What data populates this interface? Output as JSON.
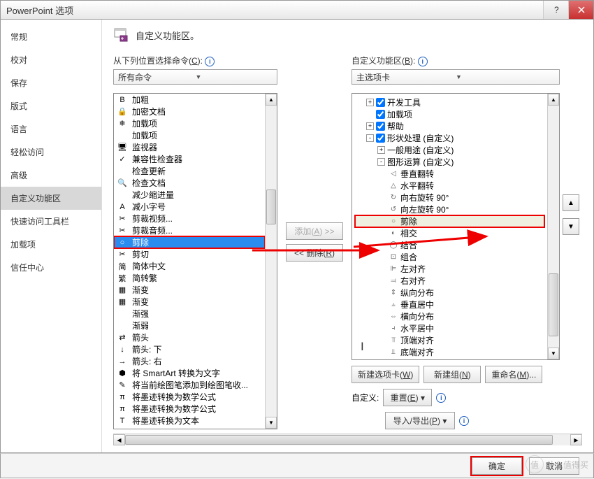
{
  "window": {
    "title": "PowerPoint 选项"
  },
  "sidebar": {
    "items": [
      "常规",
      "校对",
      "保存",
      "版式",
      "语言",
      "轻松访问",
      "高级",
      "自定义功能区",
      "快速访问工具栏",
      "加载项",
      "信任中心"
    ],
    "selectedIndex": 7
  },
  "header": {
    "title": "自定义功能区。"
  },
  "leftPanel": {
    "label_pre": "从下列位置选择命令(",
    "label_key": "C",
    "label_post": "):",
    "dropdown": "所有命令",
    "items": [
      {
        "icon": "B",
        "label": "加粗"
      },
      {
        "icon": "🔒",
        "label": "加密文档"
      },
      {
        "icon": "❄",
        "label": "加载项"
      },
      {
        "icon": "",
        "label": "加载项"
      },
      {
        "icon": "🖥",
        "label": "监视器"
      },
      {
        "icon": "✓",
        "label": "兼容性检查器"
      },
      {
        "icon": "",
        "label": "检查更新"
      },
      {
        "icon": "🔍",
        "label": "检查文档"
      },
      {
        "icon": "",
        "label": "减少缩进量"
      },
      {
        "icon": "A",
        "label": "减小字号"
      },
      {
        "icon": "✂",
        "label": "剪裁视频..."
      },
      {
        "icon": "✂",
        "label": "剪裁音频..."
      },
      {
        "icon": "○",
        "label": "剪除",
        "selected": true,
        "redBorder": true
      },
      {
        "icon": "✂",
        "label": "剪切"
      },
      {
        "icon": "简",
        "label": "简体中文"
      },
      {
        "icon": "繁",
        "label": "简转繁"
      },
      {
        "icon": "▦",
        "label": "渐变"
      },
      {
        "icon": "▦",
        "label": "渐变"
      },
      {
        "icon": "",
        "label": "渐强"
      },
      {
        "icon": "",
        "label": "渐弱"
      },
      {
        "icon": "⇄",
        "label": "箭头"
      },
      {
        "icon": "↓",
        "label": "箭头: 下"
      },
      {
        "icon": "→",
        "label": "箭头: 右"
      },
      {
        "icon": "⬢",
        "label": "将 SmartArt 转换为文字"
      },
      {
        "icon": "✎",
        "label": "将当前绘图笔添加到绘图笔收..."
      },
      {
        "icon": "π",
        "label": "将墨迹转换为数学公式"
      },
      {
        "icon": "π",
        "label": "将墨迹转换为数学公式"
      },
      {
        "icon": "T",
        "label": "将墨迹转换为文本"
      }
    ]
  },
  "middle": {
    "add_pre": "添加(",
    "add_key": "A",
    "add_post": ") >>",
    "remove_pre": "<< 删除(",
    "remove_key": "R",
    "remove_post": ")"
  },
  "rightPanel": {
    "label_pre": "自定义功能区(",
    "label_key": "B",
    "label_post": "):",
    "dropdown": "主选项卡",
    "tree": [
      {
        "type": "tab",
        "expand": "+",
        "checked": true,
        "label": "开发工具",
        "indent": 1
      },
      {
        "type": "tab",
        "expand": "",
        "checked": true,
        "label": "加载项",
        "indent": 1
      },
      {
        "type": "tab",
        "expand": "+",
        "checked": true,
        "label": "帮助",
        "indent": 1
      },
      {
        "type": "tab",
        "expand": "-",
        "checked": true,
        "label": "形状处理 (自定义)",
        "indent": 1
      },
      {
        "type": "group",
        "expand": "+",
        "label": "一般用途 (自定义)",
        "indent": 2
      },
      {
        "type": "group",
        "expand": "-",
        "label": "图形运算 (自定义)",
        "indent": 2
      },
      {
        "type": "cmd",
        "icon": "◁",
        "label": "垂直翻转",
        "indent": 3
      },
      {
        "type": "cmd",
        "icon": "△",
        "label": "水平翻转",
        "indent": 3
      },
      {
        "type": "cmd",
        "icon": "↻",
        "label": "向右旋转 90°",
        "indent": 3
      },
      {
        "type": "cmd",
        "icon": "↺",
        "label": "向左旋转 90°",
        "indent": 3
      },
      {
        "type": "cmd",
        "icon": "○",
        "label": "剪除",
        "indent": 3,
        "highlighted": true
      },
      {
        "type": "cmd",
        "icon": "◐",
        "label": "相交",
        "indent": 3
      },
      {
        "type": "cmd",
        "icon": "◯",
        "label": "结合",
        "indent": 3
      },
      {
        "type": "cmd",
        "icon": "⊡",
        "label": "组合",
        "indent": 3
      },
      {
        "type": "cmd",
        "icon": "⊫",
        "label": "左对齐",
        "indent": 3
      },
      {
        "type": "cmd",
        "icon": "⫤",
        "label": "右对齐",
        "indent": 3
      },
      {
        "type": "cmd",
        "icon": "⇕",
        "label": "纵向分布",
        "indent": 3
      },
      {
        "type": "cmd",
        "icon": "⫨",
        "label": "垂直居中",
        "indent": 3
      },
      {
        "type": "cmd",
        "icon": "⇔",
        "label": "横向分布",
        "indent": 3
      },
      {
        "type": "cmd",
        "icon": "⫞",
        "label": "水平居中",
        "indent": 3
      },
      {
        "type": "cmd",
        "icon": "⫪",
        "label": "顶端对齐",
        "indent": 3
      },
      {
        "type": "cmd",
        "icon": "⫫",
        "label": "底端对齐",
        "indent": 3
      }
    ],
    "buttons": {
      "newTab_pre": "新建选项卡(",
      "newTab_key": "W",
      "newTab_post": ")",
      "newGroup_pre": "新建组(",
      "newGroup_key": "N",
      "newGroup_post": ")",
      "rename_pre": "重命名(",
      "rename_key": "M",
      "rename_post": ")..."
    },
    "customize": {
      "label": "自定义:",
      "reset_pre": "重置(",
      "reset_key": "E",
      "reset_post": ")",
      "import_pre": "导入/导出(",
      "import_key": "P",
      "import_post": ")"
    }
  },
  "footer": {
    "ok": "确定",
    "cancel": "取消"
  },
  "watermark": {
    "text": "什么值得买",
    "short": "值"
  }
}
